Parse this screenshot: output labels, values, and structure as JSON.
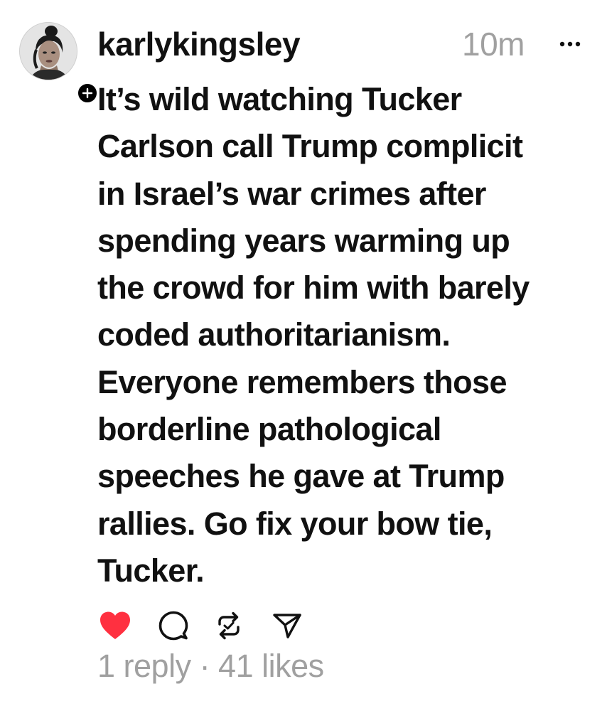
{
  "post": {
    "username": "karlykingsley",
    "time": "10m",
    "more_icon": "more-horizontal-icon",
    "follow_icon": "plus-icon",
    "text_lines": [
      "It’s wild watching Tucker",
      "Carlson call Trump complicit",
      "in Israel’s war crimes after",
      "spending years warming up",
      "the crowd for him with barely",
      "coded authoritarianism.",
      "Everyone remembers those",
      "borderline pathological",
      "speeches he gave at Trump",
      "rallies. Go fix your bow tie,",
      "Tucker."
    ],
    "actions": {
      "like_icon": "heart-filled-icon",
      "reply_icon": "comment-icon",
      "repost_icon": "repost-icon",
      "share_icon": "send-icon",
      "liked": true
    },
    "stats": "1 reply · 41 likes"
  },
  "colors": {
    "text": "#111111",
    "muted": "#a0a0a0",
    "like": "#ff3040",
    "background": "#ffffff"
  }
}
